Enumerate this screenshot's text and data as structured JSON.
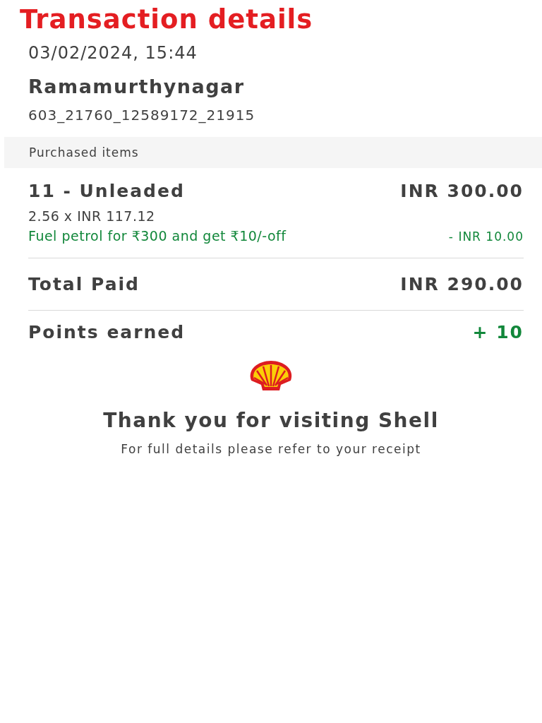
{
  "title": "Transaction details",
  "datetime": "03/02/2024, 15:44",
  "station": "Ramamurthynagar",
  "transaction_id": "603_21760_12589172_21915",
  "section_header": "Purchased items",
  "items": [
    {
      "name": "11 - Unleaded",
      "amount": "INR 300.00",
      "quantity": "2.56 x INR 117.12",
      "discount_label": "Fuel petrol for ₹300 and get ₹10/-off",
      "discount_amount": "- INR 10.00"
    }
  ],
  "total": {
    "label": "Total Paid",
    "amount": "INR 290.00"
  },
  "points": {
    "label": "Points earned",
    "value": "+ 10"
  },
  "thank_you": "Thank you for visiting Shell",
  "note": "For full details please refer to your receipt"
}
